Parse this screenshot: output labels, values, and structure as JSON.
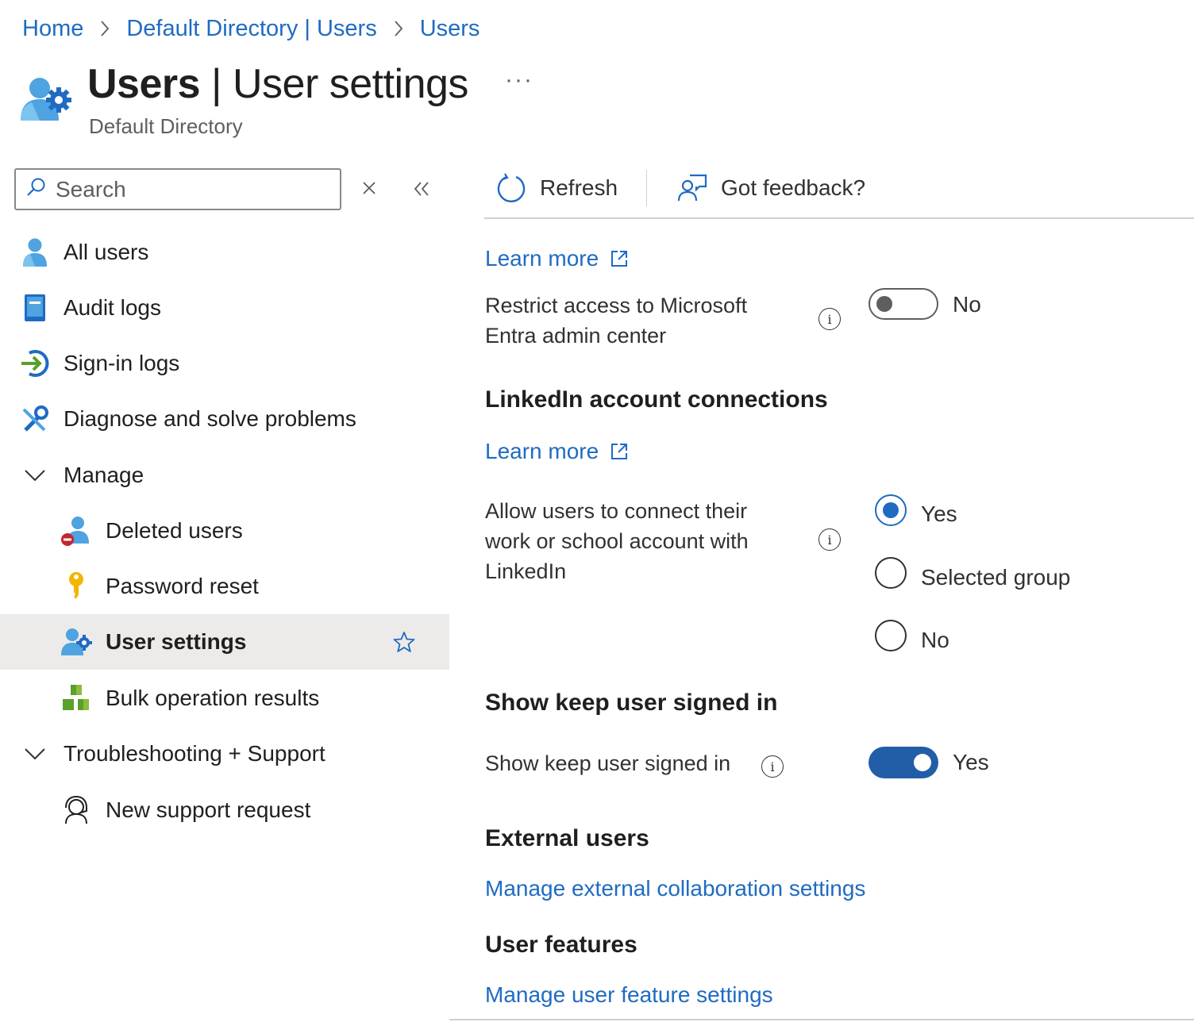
{
  "breadcrumb": {
    "items": [
      "Home",
      "Default Directory | Users",
      "Users"
    ]
  },
  "header": {
    "title_bold": "Users",
    "title_sep": " | ",
    "title_rest": "User settings",
    "more": "···",
    "subtitle": "Default Directory"
  },
  "search": {
    "placeholder": "Search"
  },
  "sidebar": {
    "items": [
      {
        "label": "All users",
        "icon": "user-icon"
      },
      {
        "label": "Audit logs",
        "icon": "audit-log-icon"
      },
      {
        "label": "Sign-in logs",
        "icon": "sign-in-icon"
      },
      {
        "label": "Diagnose and solve problems",
        "icon": "wrench-icon"
      },
      {
        "label": "Manage",
        "icon": "chevron-down-icon"
      },
      {
        "label": "Deleted users",
        "icon": "deleted-user-icon"
      },
      {
        "label": "Password reset",
        "icon": "key-icon"
      },
      {
        "label": "User settings",
        "icon": "user-settings-icon",
        "active": true
      },
      {
        "label": "Bulk operation results",
        "icon": "cubes-icon"
      },
      {
        "label": "Troubleshooting + Support",
        "icon": "chevron-down-icon"
      },
      {
        "label": "New support request",
        "icon": "support-icon"
      }
    ]
  },
  "toolbar": {
    "refresh_label": "Refresh",
    "feedback_label": "Got feedback?"
  },
  "content": {
    "learn_more_1": "Learn more",
    "restrict_label": "Restrict access to Microsoft Entra admin center",
    "restrict_value": "No",
    "linkedin_heading": "LinkedIn account connections",
    "learn_more_2": "Learn more",
    "linkedin_label": "Allow users to connect their work or school account with LinkedIn",
    "linkedin_options": [
      "Yes",
      "Selected group",
      "No"
    ],
    "linkedin_selected": "Yes",
    "keep_signed_heading": "Show keep user signed in",
    "keep_signed_label": "Show keep user signed in",
    "keep_signed_value": "Yes",
    "external_heading": "External users",
    "external_link": "Manage external collaboration settings",
    "features_heading": "User features",
    "features_link": "Manage user feature settings"
  },
  "colors": {
    "link": "#1f6bc2",
    "toggle_on": "#225ea8",
    "active_bg": "#edebe9",
    "text": "#323130"
  }
}
